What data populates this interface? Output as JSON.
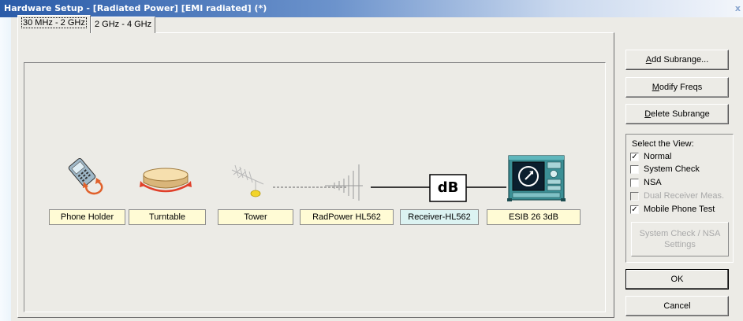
{
  "window": {
    "title": "Hardware Setup  -  [Radiated Power] [EMI radiated] (*)",
    "close_glyph": "x"
  },
  "tabs": [
    {
      "label": "30 MHz - 2 GHz",
      "active": true
    },
    {
      "label": "2 GHz - 4 GHz",
      "active": false
    }
  ],
  "chain": {
    "devices": [
      {
        "label": "Phone Holder",
        "icon": "phone-holder-icon"
      },
      {
        "label": "Turntable",
        "icon": "turntable-icon"
      },
      {
        "label": "Tower",
        "icon": "tower-icon"
      },
      {
        "label": "RadPower HL562",
        "icon": "antenna-icon"
      },
      {
        "label": "Receiver-HL562",
        "icon": "receiver-db-icon",
        "highlighted": true
      },
      {
        "label": "ESIB 26 3dB",
        "icon": "analyzer-icon"
      }
    ],
    "db_text": "dB"
  },
  "buttons": {
    "add_subrange": "Add Subrange...",
    "modify_freqs": "Modify Freqs",
    "delete_subrange": "Delete Subrange",
    "system_check_nsa": "System Check / NSA Settings",
    "ok": "OK",
    "cancel": "Cancel"
  },
  "view": {
    "title": "Select the View:",
    "options": [
      {
        "label": "Normal",
        "checked": true,
        "enabled": true
      },
      {
        "label": "System Check",
        "checked": false,
        "enabled": true
      },
      {
        "label": "NSA",
        "checked": false,
        "enabled": true
      },
      {
        "label": "Dual Receiver Meas.",
        "checked": false,
        "enabled": false
      },
      {
        "label": "Mobile Phone Test",
        "checked": true,
        "enabled": true
      }
    ]
  },
  "colors": {
    "title_bar": "#2a5ba8",
    "label_yellow": "#fffbd5",
    "label_cyan": "#dcf3f2",
    "dialog_bg": "#ecebe6"
  }
}
